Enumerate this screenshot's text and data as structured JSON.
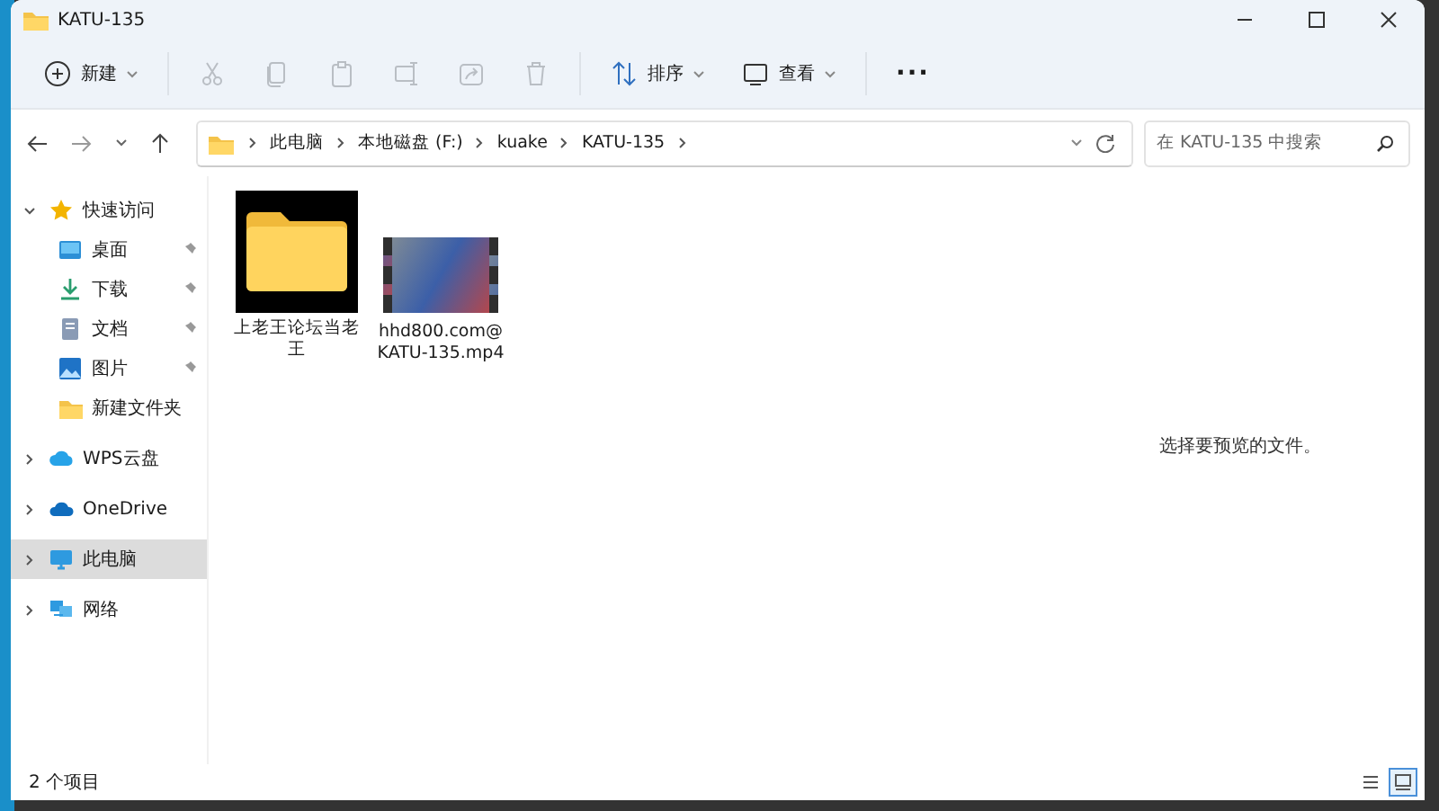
{
  "window": {
    "title": "KATU-135"
  },
  "toolbar": {
    "items": [
      {
        "kind": "new",
        "label": "新建",
        "disabled": false
      },
      {
        "kind": "cut",
        "disabled": true
      },
      {
        "kind": "copy",
        "disabled": true
      },
      {
        "kind": "paste",
        "disabled": true
      },
      {
        "kind": "rename",
        "disabled": true
      },
      {
        "kind": "share",
        "disabled": true
      },
      {
        "kind": "delete",
        "disabled": true
      },
      {
        "kind": "sort",
        "label": "排序",
        "disabled": false
      },
      {
        "kind": "view",
        "label": "查看",
        "disabled": false
      },
      {
        "kind": "more",
        "label": "···",
        "disabled": false
      }
    ]
  },
  "address": {
    "path": [
      "此电脑",
      "本地磁盘 (F:)",
      "kuake",
      "KATU-135"
    ]
  },
  "search": {
    "placeholder": "在 KATU-135 中搜索"
  },
  "sidebar": {
    "items": [
      {
        "kind": "star",
        "label": "快速访问",
        "expanded": true,
        "selected": false,
        "children": [
          {
            "kind": "desktop",
            "label": "桌面",
            "pinned": true
          },
          {
            "kind": "download",
            "label": "下载",
            "pinned": true
          },
          {
            "kind": "document",
            "label": "文档",
            "pinned": true
          },
          {
            "kind": "picture",
            "label": "图片",
            "pinned": true
          },
          {
            "kind": "folder",
            "label": "新建文件夹",
            "pinned": false
          }
        ]
      },
      {
        "kind": "cloud",
        "label": "WPS云盘",
        "expanded": false,
        "selected": false
      },
      {
        "kind": "onedrive",
        "label": "OneDrive",
        "expanded": false,
        "selected": false
      },
      {
        "kind": "pc",
        "label": "此电脑",
        "expanded": false,
        "selected": true
      },
      {
        "kind": "network",
        "label": "网络",
        "expanded": false,
        "selected": false
      }
    ]
  },
  "files": [
    {
      "kind": "folder",
      "name": "上老王论坛当老王"
    },
    {
      "kind": "video",
      "name": "hhd800.com@KATU-135.mp4"
    }
  ],
  "preview": {
    "message": "选择要预览的文件。"
  },
  "status_bar": {
    "count": "2 个项目",
    "views": [
      {
        "kind": "details",
        "selected": false
      },
      {
        "kind": "tiles",
        "selected": true
      }
    ]
  }
}
